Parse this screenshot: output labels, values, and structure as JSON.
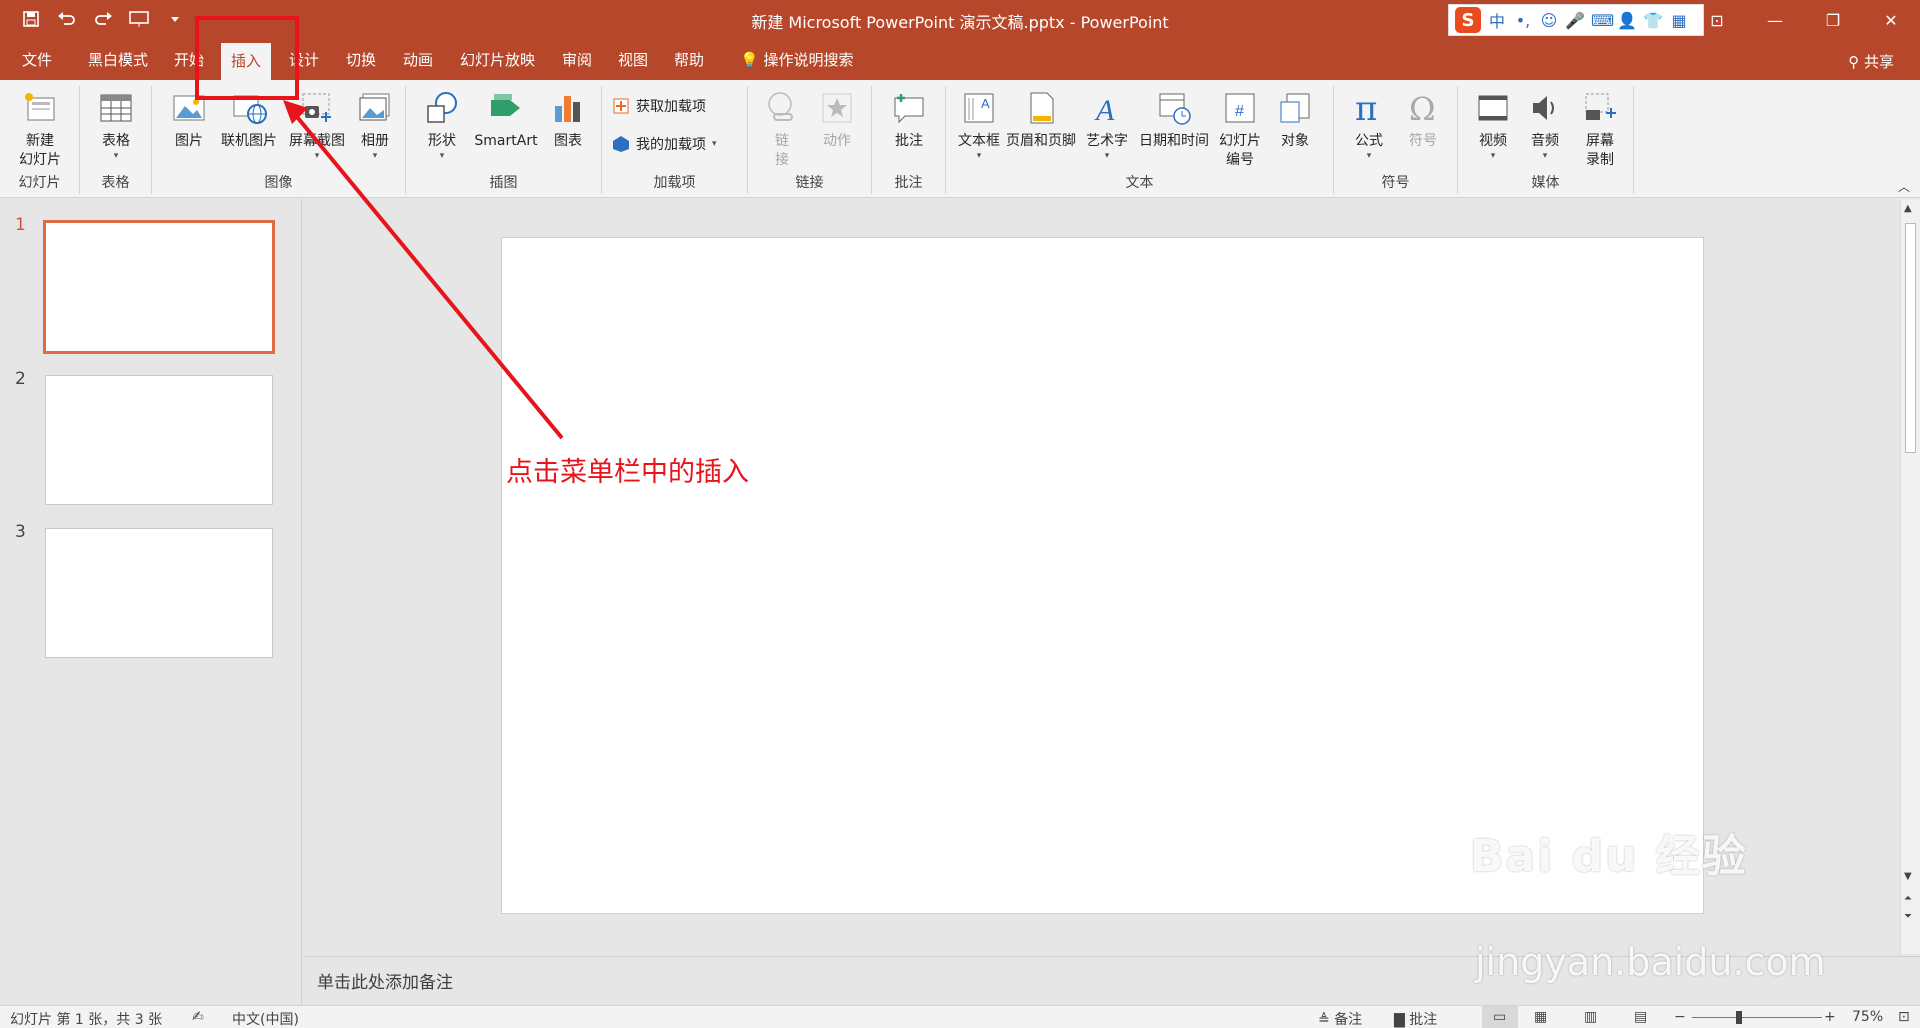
{
  "titlebar": {
    "title": "新建 Microsoft PowerPoint 演示文稿.pptx  -  PowerPoint",
    "ime_lang": "中",
    "ime_punct": "•,"
  },
  "menu": {
    "tabs": [
      "文件",
      "黑白模式",
      "开始",
      "插入",
      "设计",
      "切换",
      "动画",
      "幻灯片放映",
      "审阅",
      "视图",
      "帮助"
    ],
    "active_tab": "插入",
    "search_label": "操作说明搜索",
    "share_label": "共享"
  },
  "ribbon": {
    "groups": {
      "slides": {
        "label": "幻灯片",
        "new_slide_line1": "新建",
        "new_slide_line2": "幻灯片"
      },
      "tables": {
        "label": "表格",
        "table": "表格"
      },
      "images": {
        "label": "图像",
        "picture": "图片",
        "online_picture": "联机图片",
        "screenshot": "屏幕截图",
        "album": "相册"
      },
      "illustrations": {
        "label": "插图",
        "shapes": "形状",
        "smartart": "SmartArt",
        "chart": "图表"
      },
      "addins": {
        "label": "加载项",
        "get_addins": "获取加载项",
        "my_addins": "我的加载项"
      },
      "links": {
        "label": "链接",
        "link_line1": "链",
        "link_line2": "接",
        "action": "动作"
      },
      "comments": {
        "label": "批注",
        "comment": "批注"
      },
      "text": {
        "label": "文本",
        "textbox": "文本框",
        "header_footer": "页眉和页脚",
        "wordart": "艺术字",
        "datetime": "日期和时间",
        "slide_number_line1": "幻灯片",
        "slide_number_line2": "编号",
        "object": "对象"
      },
      "symbols": {
        "label": "符号",
        "equation": "公式",
        "symbol": "符号"
      },
      "media": {
        "label": "媒体",
        "video": "视频",
        "audio": "音频",
        "screen_record_line1": "屏幕",
        "screen_record_line2": "录制"
      }
    }
  },
  "thumbnails": {
    "numbers": [
      "1",
      "2",
      "3"
    ],
    "active": 1
  },
  "editor": {
    "annotation": "点击菜单栏中的插入"
  },
  "notes": {
    "placeholder": "单击此处添加备注"
  },
  "statusbar": {
    "slide_info": "幻灯片 第 1 张，共 3 张",
    "language": "中文(中国)",
    "notes": "备注",
    "comments": "批注",
    "zoom": "75%",
    "zoom_minus": "−",
    "zoom_plus": "+"
  },
  "watermark": {
    "line1": "Bai du 经验",
    "line2": "jingyan.baidu.com"
  },
  "colors": {
    "accent": "#b7472a",
    "highlight": "#e8141c",
    "active_thumb": "#e06a46"
  }
}
